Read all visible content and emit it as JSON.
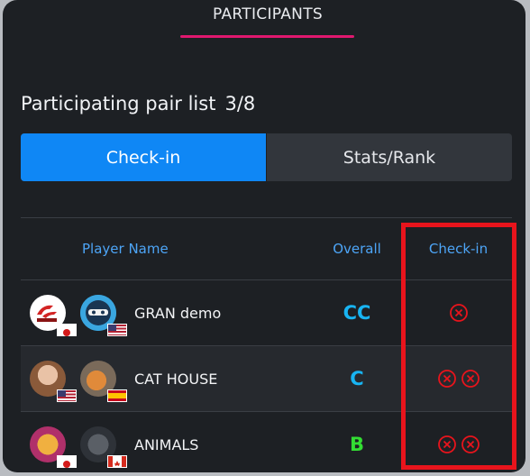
{
  "header": {
    "title": "PARTICIPANTS"
  },
  "pair_list": {
    "title": "Participating pair list",
    "count": "3/8"
  },
  "tabs": [
    {
      "label": "Check-in",
      "active": true
    },
    {
      "label": "Stats/Rank",
      "active": false
    }
  ],
  "table": {
    "columns": {
      "player": "Player Name",
      "overall": "Overall",
      "checkin": "Check-in"
    },
    "rows": [
      {
        "name": "GRAN demo",
        "overall": "CC",
        "overall_color": "#18b4f2",
        "checkin_marks": 1,
        "players": [
          {
            "avatar": "gran-logo-avatar",
            "flag": "japan-flag"
          },
          {
            "avatar": "ninja-avatar",
            "flag": "usa-flag"
          }
        ]
      },
      {
        "name": "CAT HOUSE",
        "overall": "C",
        "overall_color": "#18b4f2",
        "checkin_marks": 2,
        "players": [
          {
            "avatar": "woman-photo-avatar",
            "flag": "usa-flag"
          },
          {
            "avatar": "cat-photo-avatar",
            "flag": "spain-flag"
          }
        ]
      },
      {
        "name": "ANIMALS",
        "overall": "B",
        "overall_color": "#33dd33",
        "checkin_marks": 2,
        "players": [
          {
            "avatar": "cat-photo-avatar",
            "flag": "japan-flag"
          },
          {
            "avatar": "animal-photo-avatar",
            "flag": "canada-flag"
          }
        ]
      }
    ]
  },
  "colors": {
    "accent": "#0f87f5",
    "underline": "#e0186f",
    "not_checked": "#e8141c",
    "highlight": "#e8141c"
  }
}
